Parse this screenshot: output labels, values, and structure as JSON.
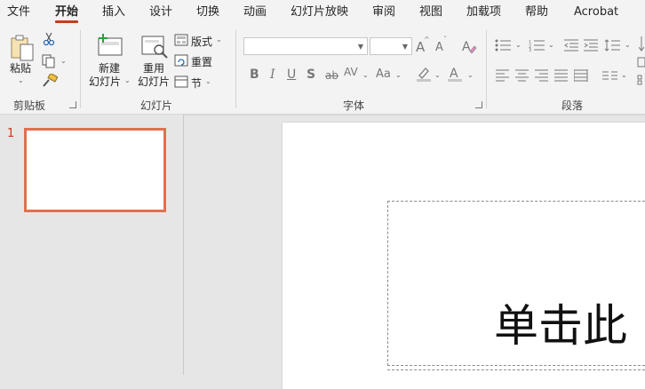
{
  "tabs": [
    {
      "label": "文件",
      "active": false
    },
    {
      "label": "开始",
      "active": true
    },
    {
      "label": "插入",
      "active": false
    },
    {
      "label": "设计",
      "active": false
    },
    {
      "label": "切换",
      "active": false
    },
    {
      "label": "动画",
      "active": false
    },
    {
      "label": "幻灯片放映",
      "active": false
    },
    {
      "label": "审阅",
      "active": false
    },
    {
      "label": "视图",
      "active": false
    },
    {
      "label": "加载项",
      "active": false
    },
    {
      "label": "帮助",
      "active": false
    },
    {
      "label": "Acrobat",
      "active": false
    }
  ],
  "ribbon": {
    "clipboard": {
      "paste_label": "粘贴",
      "group_label": "剪贴板"
    },
    "slides": {
      "new_slide_line1": "新建",
      "new_slide_line2": "幻灯片",
      "reuse_line1": "重用",
      "reuse_line2": "幻灯片",
      "layout_label": "版式",
      "reset_label": "重置",
      "section_label": "节",
      "group_label": "幻灯片"
    },
    "font": {
      "font_name": "",
      "font_size": "",
      "grow_label": "A",
      "shrink_label": "A",
      "bold": "B",
      "italic": "I",
      "underline": "U",
      "shadow": "S",
      "strike": "ab",
      "spacing": "AV",
      "case": "Aa",
      "color": "A",
      "group_label": "字体"
    },
    "paragraph": {
      "group_label": "段落"
    }
  },
  "thumbnails": [
    {
      "number": "1"
    }
  ],
  "slide": {
    "title_placeholder": "单击此"
  },
  "colors": {
    "accent": "#c43e1c",
    "thumb_border": "#e07050"
  }
}
